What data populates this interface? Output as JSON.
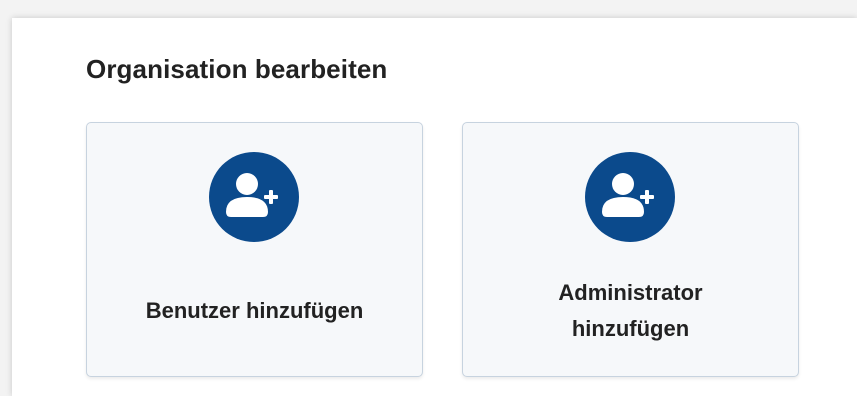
{
  "panel": {
    "title": "Organisation bearbeiten"
  },
  "cards": [
    {
      "label_lines": [
        "Benutzer hinzufügen"
      ],
      "icon": "add-user-icon"
    },
    {
      "label_lines": [
        "Administrator",
        "hinzufügen"
      ],
      "icon": "add-user-icon"
    }
  ],
  "colors": {
    "icon_circle": "#0b4a8c",
    "icon_glyph": "#ffffff",
    "card_background": "#f6f8fa",
    "card_border": "#c7d3df",
    "title_text": "#222222"
  }
}
